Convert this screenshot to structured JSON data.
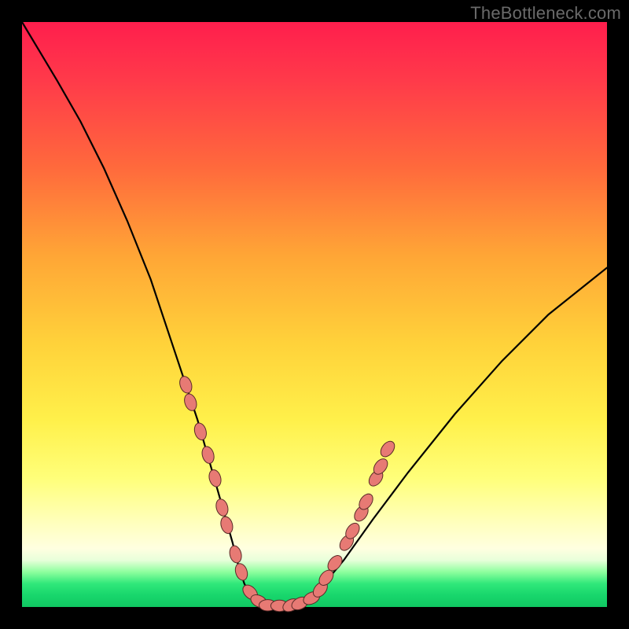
{
  "watermark": "TheBottleneck.com",
  "colors": {
    "frame": "#000000",
    "curve": "#000000",
    "marker_fill": "#e77a74",
    "marker_stroke": "#5a2b28"
  },
  "chart_data": {
    "type": "line",
    "title": "",
    "xlabel": "",
    "ylabel": "",
    "xlim": [
      0,
      100
    ],
    "ylim": [
      0,
      100
    ],
    "grid": false,
    "legend": false,
    "note": "V-shaped bottleneck curve; y≈0 near the valley indicates no bottleneck (green zone). Values estimated from pixel positions.",
    "series": [
      {
        "name": "bottleneck-curve",
        "x": [
          0,
          3,
          6,
          10,
          14,
          18,
          22,
          25,
          28,
          30,
          32,
          34,
          36,
          37,
          38,
          39,
          40,
          42,
          44,
          46,
          50,
          55,
          60,
          66,
          74,
          82,
          90,
          100
        ],
        "y": [
          100,
          95,
          90,
          83,
          75,
          66,
          56,
          47,
          38,
          32,
          25,
          18,
          11,
          7,
          4,
          2,
          1,
          0,
          0,
          0,
          2,
          8,
          15,
          23,
          33,
          42,
          50,
          58
        ]
      }
    ],
    "markers": {
      "name": "highlighted-points",
      "note": "Pink rounded markers along the lower part of the curve (left descending arm and right ascending arm, plus valley).",
      "points": [
        {
          "x": 28.0,
          "y": 38
        },
        {
          "x": 28.8,
          "y": 35
        },
        {
          "x": 30.5,
          "y": 30
        },
        {
          "x": 31.8,
          "y": 26
        },
        {
          "x": 33.0,
          "y": 22
        },
        {
          "x": 34.2,
          "y": 17
        },
        {
          "x": 35.0,
          "y": 14
        },
        {
          "x": 36.5,
          "y": 9
        },
        {
          "x": 37.5,
          "y": 6
        },
        {
          "x": 39.0,
          "y": 2.5
        },
        {
          "x": 40.5,
          "y": 1.0
        },
        {
          "x": 42.0,
          "y": 0.3
        },
        {
          "x": 44.0,
          "y": 0.2
        },
        {
          "x": 46.0,
          "y": 0.3
        },
        {
          "x": 47.5,
          "y": 0.6
        },
        {
          "x": 49.5,
          "y": 1.5
        },
        {
          "x": 51.0,
          "y": 3.0
        },
        {
          "x": 52.0,
          "y": 5.0
        },
        {
          "x": 53.5,
          "y": 7.5
        },
        {
          "x": 55.5,
          "y": 11.0
        },
        {
          "x": 56.5,
          "y": 13.0
        },
        {
          "x": 58.0,
          "y": 16.0
        },
        {
          "x": 58.8,
          "y": 18.0
        },
        {
          "x": 60.5,
          "y": 22.0
        },
        {
          "x": 61.3,
          "y": 24.0
        },
        {
          "x": 62.5,
          "y": 27.0
        }
      ]
    }
  }
}
